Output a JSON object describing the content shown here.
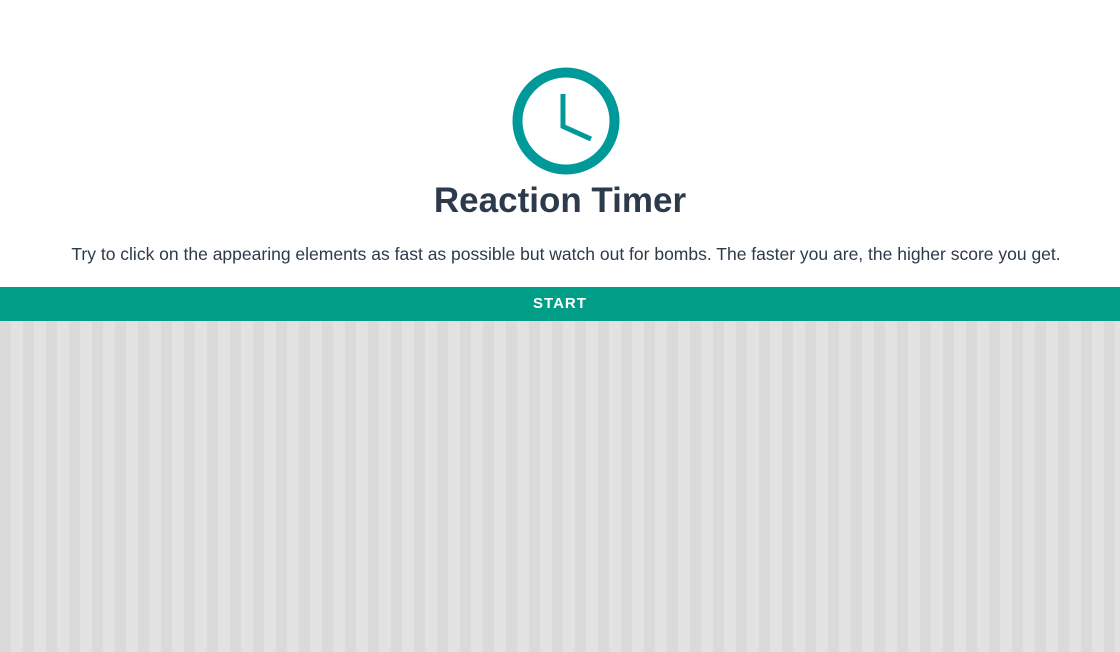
{
  "app": {
    "title": "Reaction Timer",
    "description": "Try to click on the appearing elements as fast as possible but watch out for bombs. The faster you are, the higher score you get.",
    "start_label": "START"
  },
  "icons": {
    "hero": "clock-icon"
  },
  "colors": {
    "accent": "#009e86",
    "clock": "#00999a",
    "text": "#2c3a4b",
    "game_area": "#e2e2e2",
    "game_area_stripe": "#dadada"
  }
}
